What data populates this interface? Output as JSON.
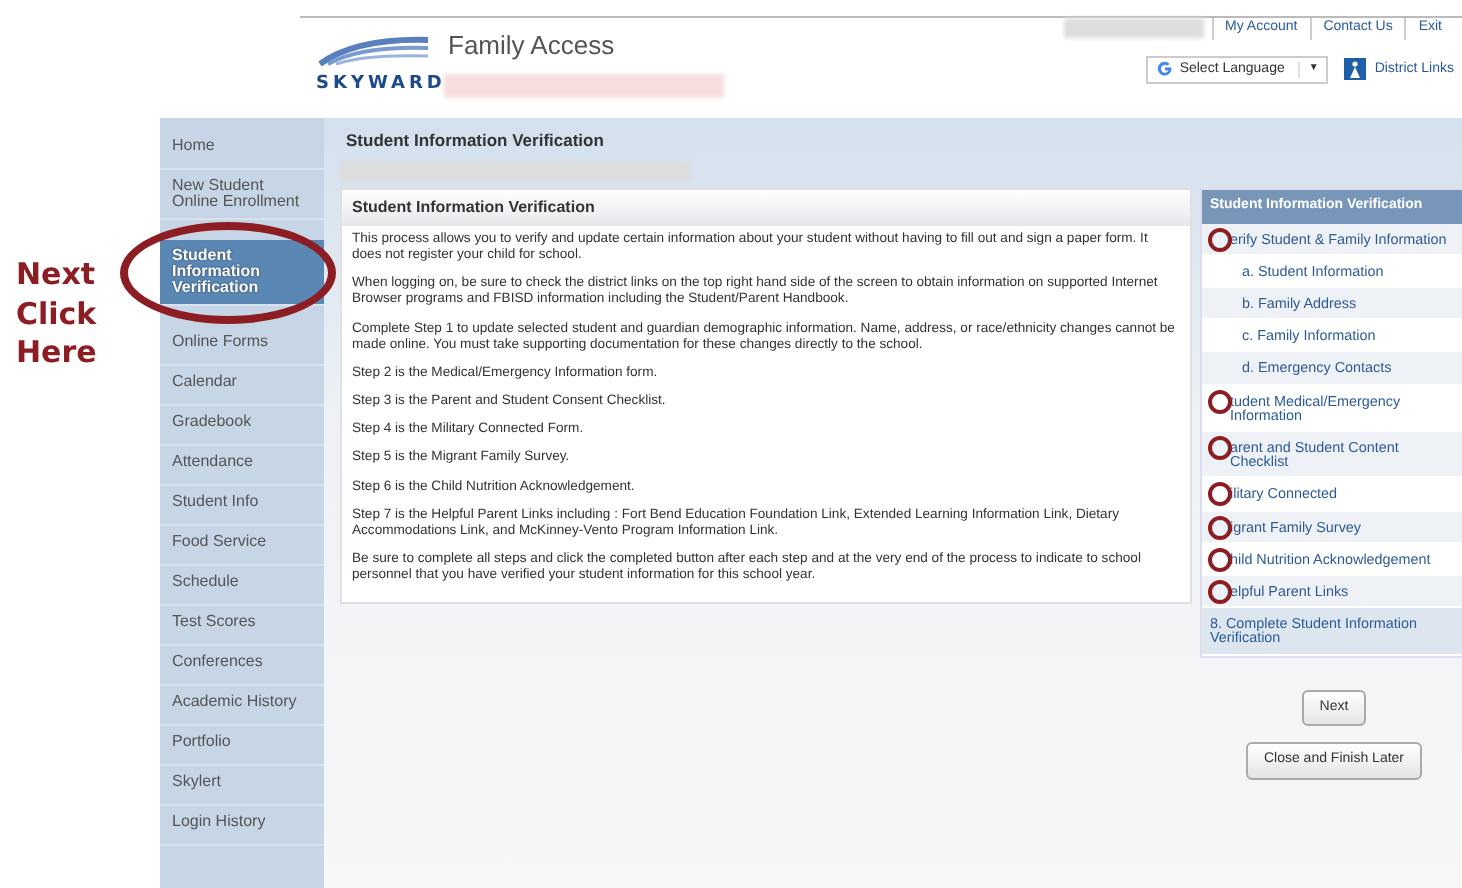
{
  "annotation": {
    "text": "Next Click Here"
  },
  "header": {
    "logo": "SKYWARD",
    "app_title": "Family Access",
    "top_links": [
      "My Account",
      "Contact Us",
      "Exit"
    ],
    "language": "Select Language",
    "language_caret": "▼",
    "district_links": "District Links"
  },
  "sidebar": {
    "items": [
      {
        "label": "Home",
        "selected": false,
        "circled": false
      },
      {
        "label": "New Student Online Enrollment",
        "selected": false,
        "circled": false
      },
      {
        "label": "Student Information Verification",
        "selected": true,
        "circled": true
      },
      {
        "label": "Online Forms",
        "selected": false,
        "circled": false
      },
      {
        "label": "Calendar",
        "selected": false,
        "circled": false
      },
      {
        "label": "Gradebook",
        "selected": false,
        "circled": false
      },
      {
        "label": "Attendance",
        "selected": false,
        "circled": false
      },
      {
        "label": "Student Info",
        "selected": false,
        "circled": false
      },
      {
        "label": "Food Service",
        "selected": false,
        "circled": false
      },
      {
        "label": "Schedule",
        "selected": false,
        "circled": false
      },
      {
        "label": "Test Scores",
        "selected": false,
        "circled": false
      },
      {
        "label": "Conferences",
        "selected": false,
        "circled": false
      },
      {
        "label": "Academic History",
        "selected": false,
        "circled": false
      },
      {
        "label": "Portfolio",
        "selected": false,
        "circled": false
      },
      {
        "label": "Skylert",
        "selected": false,
        "circled": false
      },
      {
        "label": "Login History",
        "selected": false,
        "circled": false
      }
    ]
  },
  "page_title": "Student Information Verification",
  "content": {
    "title": "Student Information Verification",
    "paragraphs": [
      "This process allows you to verify and update certain information about your student without having to fill out and sign a paper form. It does not register your child for school.",
      "When logging on, be sure to check the district links on the top right hand side of the screen to obtain information on supported Internet Browser programs and FBISD information including the Student/Parent Handbook.",
      "Complete Step 1 to update selected student and guardian demographic information. Name, address, or race/ethnicity changes cannot be made online. You must take supporting documentation for these changes directly to the school.",
      "Step 2 is the Medical/Emergency Information form.",
      "Step 3 is the Parent and Student Consent Checklist.",
      "Step 4 is the Military Connected Form.",
      "Step 5 is the Migrant Family Survey.",
      "Step 6 is the Child Nutrition Acknowledgement.",
      "Step 7 is the Helpful Parent Links including : Fort Bend Education Foundation Link, Extended Learning Information Link, Dietary Accommodations Link, and McKinney-Vento Program Information Link.",
      "Be sure to complete all steps and click the completed button after each step and at the very end of the process to indicate to school personnel that you have verified your student information for this school year."
    ]
  },
  "steps": {
    "title": "Student Information Verification",
    "items": [
      {
        "kind": "step",
        "label": "erify Student & Family Information",
        "circled": true
      },
      {
        "kind": "substep",
        "label": "a. Student Information",
        "circled": false
      },
      {
        "kind": "substep",
        "label": "b. Family Address",
        "circled": false
      },
      {
        "kind": "substep",
        "label": "c. Family Information",
        "circled": false
      },
      {
        "kind": "substep",
        "label": "d. Emergency Contacts",
        "circled": false
      },
      {
        "kind": "step",
        "label": "tudent Medical/Emergency Information",
        "circled": true
      },
      {
        "kind": "step",
        "label": "arent and Student Content Checklist",
        "circled": true
      },
      {
        "kind": "step",
        "label": "ilitary Connected",
        "circled": true
      },
      {
        "kind": "step",
        "label": "igrant Family Survey",
        "circled": true
      },
      {
        "kind": "step",
        "label": "hild Nutrition Acknowledgement",
        "circled": true
      },
      {
        "kind": "step",
        "label": "elpful Parent Links",
        "circled": true
      },
      {
        "kind": "final",
        "label": "8. Complete Student Information Verification",
        "circled": false
      }
    ]
  },
  "buttons": [
    "Next",
    "Close and Finish Later"
  ]
}
